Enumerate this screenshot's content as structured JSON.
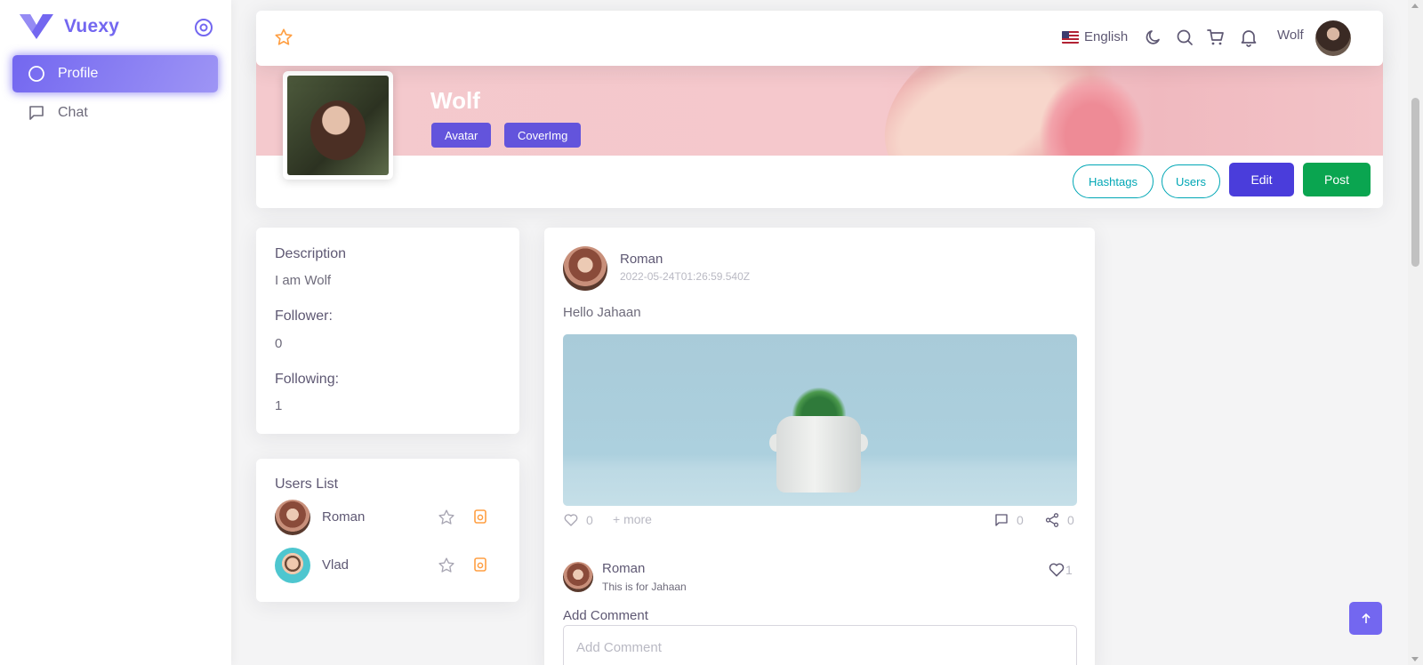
{
  "app": {
    "brand": "Vuexy",
    "brand_color": "#7367f0"
  },
  "sidebar": {
    "items": [
      {
        "label": "Profile",
        "icon": "circle-icon",
        "active": true
      },
      {
        "label": "Chat",
        "icon": "message-square-icon",
        "active": false
      }
    ]
  },
  "navbar": {
    "language": "English",
    "user_name": "Wolf",
    "icons": [
      "star-icon",
      "moon-icon",
      "search-icon",
      "cart-icon",
      "bell-icon"
    ]
  },
  "profile": {
    "name": "Wolf",
    "cover_buttons": {
      "avatar": "Avatar",
      "cover": "CoverImg"
    },
    "actions": {
      "hashtags": "Hashtags",
      "users": "Users",
      "edit": "Edit",
      "post": "Post"
    },
    "colors": {
      "primary": "#6354dc",
      "edit": "#4a3ddb",
      "post": "#0aa550",
      "outline": "#00a7b5"
    }
  },
  "info": {
    "description_label": "Description",
    "description": "I am Wolf",
    "follower_label": "Follower:",
    "follower_count": "0",
    "following_label": "Following:",
    "following_count": "1"
  },
  "users_list": {
    "title": "Users List",
    "users": [
      {
        "name": "Roman"
      },
      {
        "name": "Vlad"
      }
    ]
  },
  "post": {
    "author": "Roman",
    "timestamp": "2022-05-24T01:26:59.540Z",
    "text": "Hello Jahaan",
    "likes": "0",
    "more": "+ more",
    "comments_count": "0",
    "shares": "0",
    "comment": {
      "author": "Roman",
      "text": "This is for Jahaan",
      "likes": "1"
    },
    "add_comment_label": "Add Comment",
    "add_comment_placeholder": "Add Comment"
  }
}
